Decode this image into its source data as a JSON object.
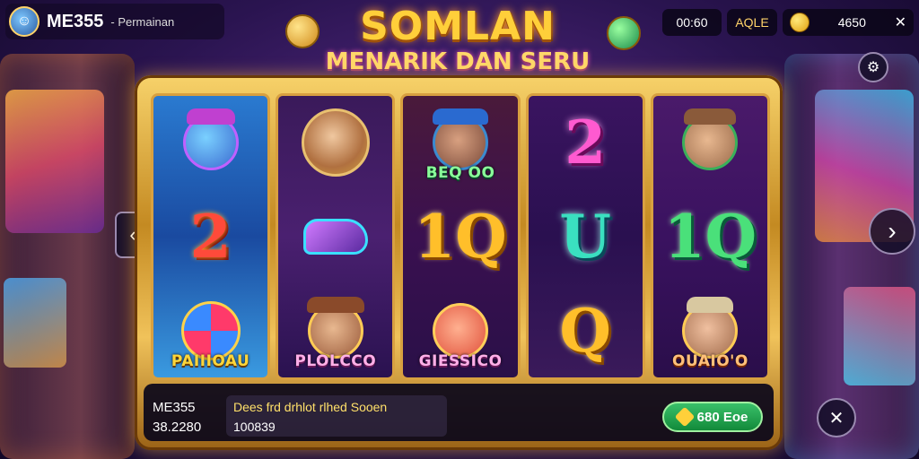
{
  "header": {
    "brand": "ME355",
    "subtitle": "- Permainan",
    "title": "SOMLAN",
    "tagline": "MENARIK DAN SERU"
  },
  "status": {
    "time": "00:60",
    "level": "AQLE",
    "balance": "4650"
  },
  "reels": [
    {
      "symbols": [
        "joker-cat",
        "2",
        "PAIIIOAU"
      ]
    },
    {
      "symbols": [
        "gold-portrait",
        "boot",
        "PLOLCCO"
      ]
    },
    {
      "symbols": [
        "BEO OO",
        "1Q",
        "GIESSICO"
      ]
    },
    {
      "symbols": [
        "2",
        "U",
        "Q"
      ]
    },
    {
      "symbols": [
        "explorer",
        "1Q",
        "OUAIO'O"
      ]
    }
  ],
  "labels": {
    "r1": "PAIIIOAU",
    "r2": "PLOLCCO",
    "r3_top": "BEQ OO",
    "r3_bot": "GIESSICO",
    "r5": "OUAIO'O"
  },
  "glyphs": {
    "r1": "2",
    "r3": "1Q",
    "r4_top": "2",
    "r4_mid": "U",
    "r4_bot": "Q",
    "r5": "1Q"
  },
  "footer": {
    "game_id": "ME355",
    "game_value": "38.2280",
    "message": "Dees frd drhlot rlhed Sooen",
    "amount": "100839",
    "play_label": "680 Eoe"
  },
  "icons": {
    "left_arrow": "chevron-left-icon",
    "right_arrow": "chevron-right-icon",
    "close": "close-icon",
    "settings": "settings-icon"
  }
}
